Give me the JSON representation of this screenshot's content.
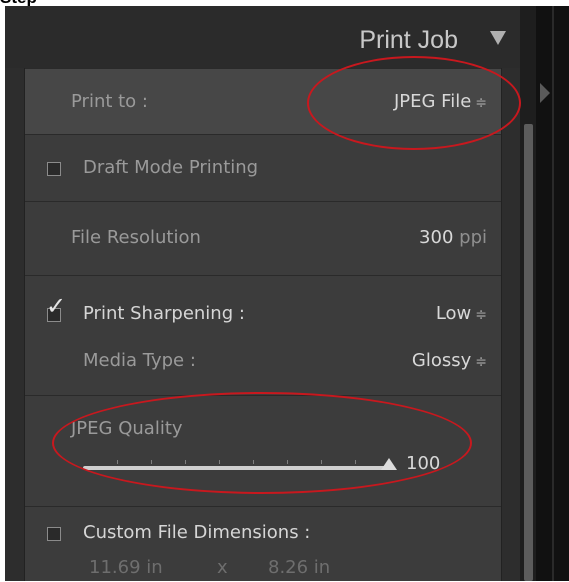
{
  "page_top_label": "Step",
  "header": {
    "title": "Print Job"
  },
  "print_to": {
    "label": "Print to :",
    "value": "JPEG File"
  },
  "draft_mode": {
    "label": "Draft Mode Printing",
    "checked": false
  },
  "file_resolution": {
    "label": "File Resolution",
    "value": "300",
    "unit": "ppi"
  },
  "print_sharpening": {
    "label": "Print Sharpening :",
    "value": "Low",
    "checked": true
  },
  "media_type": {
    "label": "Media Type :",
    "value": "Glossy"
  },
  "jpeg_quality": {
    "label": "JPEG Quality",
    "value": "100",
    "level_percent": 100
  },
  "custom_dimensions": {
    "label": "Custom File Dimensions :",
    "width": "11.69 in",
    "x": "x",
    "height": "8.26 in",
    "checked": false
  },
  "colors": {
    "highlight_ellipse": "#c8181e",
    "panel_bg": "#3c3c3c"
  },
  "icons": {
    "updown": "⇕",
    "collapse": "triangle-down-icon",
    "expand_right": "triangle-right-icon"
  }
}
